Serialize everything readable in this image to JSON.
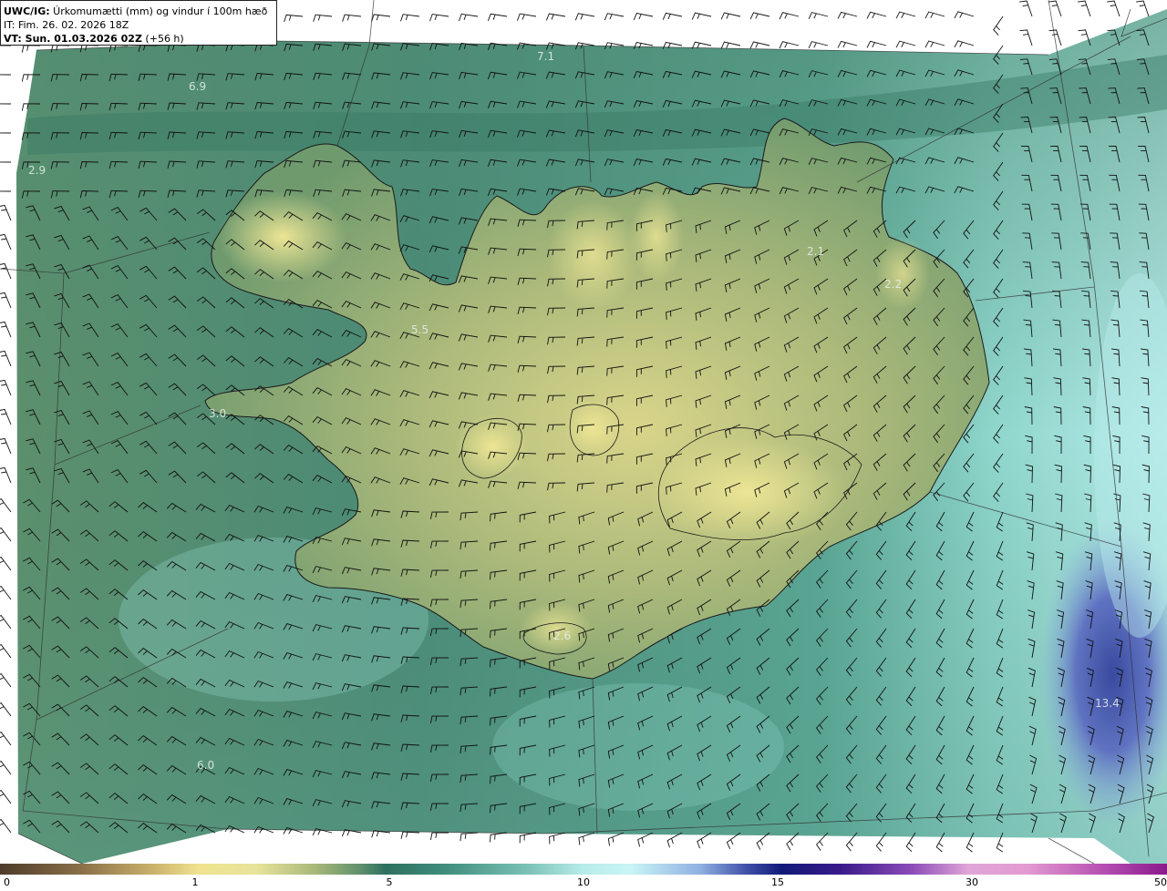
{
  "header": {
    "model": "UWC/IG:",
    "title": " Úrkomumætti (mm) og vindur í 100m hæð",
    "init_time": "IT: Fim. 26. 02. 2026 18Z",
    "valid_time": "VT: Sun. 01.03.2026 02Z",
    "lead_time": " (+56 h)"
  },
  "value_labels": [
    {
      "text": "7.1"
    },
    {
      "text": "6.9"
    },
    {
      "text": "2.9"
    },
    {
      "text": "5.5"
    },
    {
      "text": "3.0"
    },
    {
      "text": "2.1"
    },
    {
      "text": "2.2"
    },
    {
      "text": "2.6"
    },
    {
      "text": "13.4"
    },
    {
      "text": "6.0"
    }
  ],
  "colorbar": {
    "ticks": [
      "0",
      "1",
      "5",
      "10",
      "15",
      "30",
      "50"
    ]
  },
  "colors": {
    "ocean_deep": "#2f6e5e",
    "ocean_mid": "#4f8f7c",
    "land_low": "#8aa86a",
    "land_high": "#e6df90",
    "high_precip": "#3f52b0",
    "coast": "#1a1a1a"
  }
}
